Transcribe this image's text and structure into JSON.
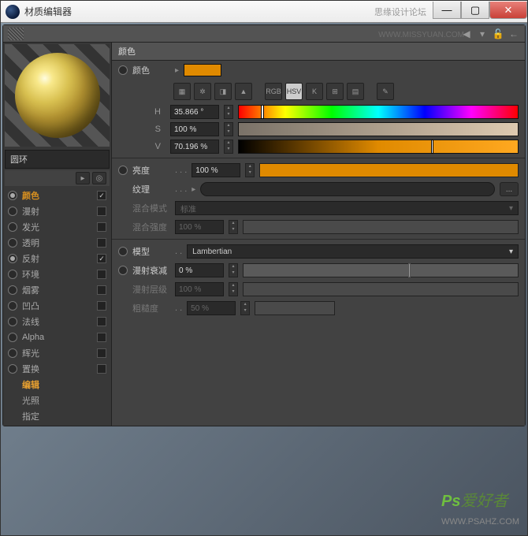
{
  "titlebar": {
    "title": "材质编辑器",
    "watermark": "思缘设计论坛"
  },
  "toolbar": {
    "arrow_left": "◀",
    "lock": "🔒",
    "arrow_r": "←"
  },
  "material": {
    "name": "圆环"
  },
  "channels": [
    {
      "label": "颜色",
      "checked": true,
      "active": true,
      "hasCheck": true
    },
    {
      "label": "漫射",
      "checked": false,
      "active": false,
      "hasCheck": true
    },
    {
      "label": "发光",
      "checked": false,
      "active": false,
      "hasCheck": true
    },
    {
      "label": "透明",
      "checked": false,
      "active": false,
      "hasCheck": true
    },
    {
      "label": "反射",
      "checked": true,
      "active": false,
      "hasCheck": true
    },
    {
      "label": "环境",
      "checked": false,
      "active": false,
      "hasCheck": true
    },
    {
      "label": "烟雾",
      "checked": false,
      "active": false,
      "hasCheck": true
    },
    {
      "label": "凹凸",
      "checked": false,
      "active": false,
      "hasCheck": true
    },
    {
      "label": "法线",
      "checked": false,
      "active": false,
      "hasCheck": true
    },
    {
      "label": "Alpha",
      "checked": false,
      "active": false,
      "hasCheck": true
    },
    {
      "label": "辉光",
      "checked": false,
      "active": false,
      "hasCheck": true
    },
    {
      "label": "置换",
      "checked": false,
      "active": false,
      "hasCheck": true
    },
    {
      "label": "编辑",
      "checked": false,
      "active": false,
      "hasCheck": false,
      "editor": true
    },
    {
      "label": "光照",
      "checked": false,
      "active": false,
      "hasCheck": false
    },
    {
      "label": "指定",
      "checked": false,
      "active": false,
      "hasCheck": false
    }
  ],
  "panel": {
    "header": "颜色",
    "color_label": "颜色",
    "icons": {
      "rgb": "RGB",
      "hsv": "HSV",
      "k": "K"
    },
    "hsv": {
      "h_label": "H",
      "h_value": "35.866 °",
      "s_label": "S",
      "s_value": "100 %",
      "v_label": "V",
      "v_value": "70.196 %"
    },
    "brightness": {
      "label": "亮度",
      "value": "100 %"
    },
    "texture": {
      "label": "纹理"
    },
    "mix_mode": {
      "label": "混合模式",
      "value": "标准"
    },
    "mix_strength": {
      "label": "混合强度",
      "value": "100 %"
    },
    "model": {
      "label": "模型",
      "value": "Lambertian"
    },
    "diffuse_falloff": {
      "label": "漫射衰减",
      "value": "0 %"
    },
    "diffuse_level": {
      "label": "漫射层级",
      "value": "100 %"
    },
    "roughness": {
      "label": "粗糙度",
      "value": "50 %"
    }
  },
  "colors": {
    "accent": "#e08a00"
  },
  "watermark_br": {
    "ps": "Ps",
    "text": "爱好者",
    "url": "WWW.PSAHZ.COM"
  },
  "watermark_url": "WWW.MISSYUAN.COM"
}
